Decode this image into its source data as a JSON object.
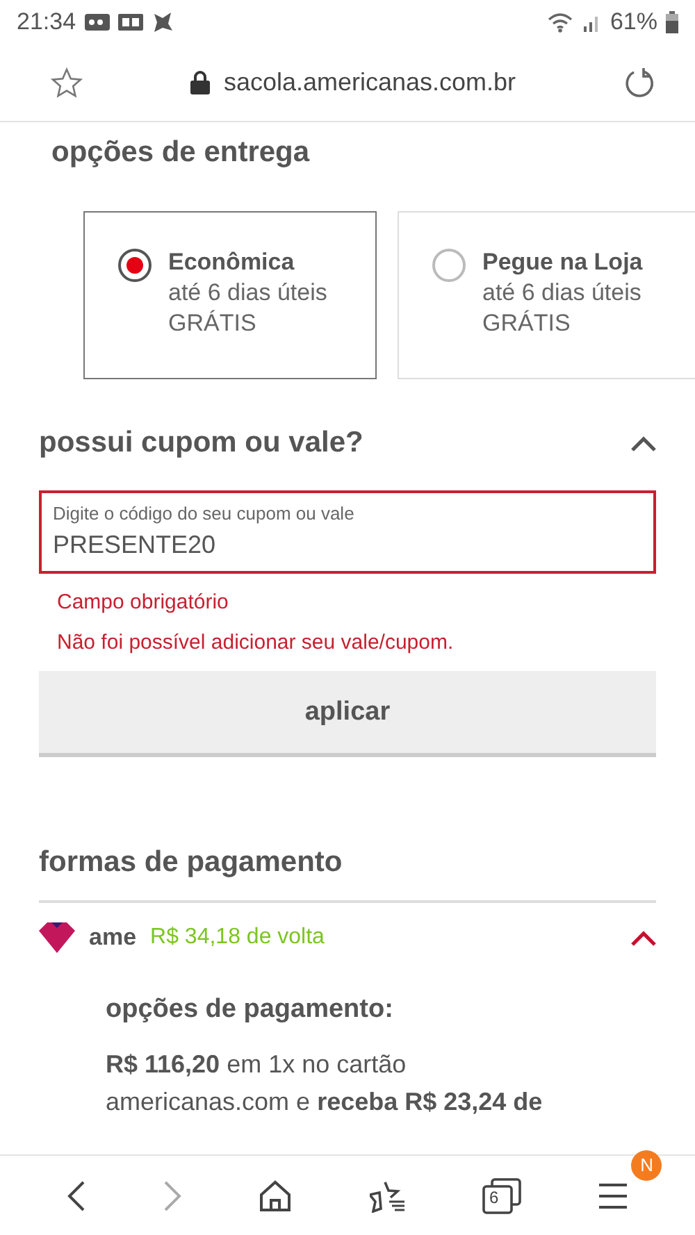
{
  "status_bar": {
    "time": "21:34",
    "battery": "61%"
  },
  "address_bar": {
    "url": "sacola.americanas.com.br"
  },
  "delivery": {
    "title": "opções de entrega",
    "options": [
      {
        "name": "Econômica",
        "time": "até 6 dias úteis",
        "price": "GRÁTIS",
        "selected": true
      },
      {
        "name": "Pegue na Loja",
        "time": "até 6 dias úteis",
        "price": "GRÁTIS",
        "selected": false
      }
    ]
  },
  "coupon": {
    "title": "possui cupom ou vale?",
    "expanded": true,
    "field_label": "Digite o código do seu cupom ou vale",
    "value": "PRESENTE20",
    "errors": [
      "Campo obrigatório",
      "Não foi possível adicionar seu vale/cupom."
    ],
    "button": "aplicar"
  },
  "payment": {
    "title": "formas de pagamento",
    "method": {
      "name": "ame",
      "cashback": "R$ 34,18 de volta",
      "expanded": true
    },
    "options_title": "opções de pagamento:",
    "lines": [
      "**R$ 116,20** em 1x no cartão",
      "americanas.com e **receba R$ 23,24 de**"
    ]
  },
  "nav_bar": {
    "back_enabled": true,
    "forward_enabled": false,
    "tab_count": "6",
    "menu_badge": "N"
  }
}
